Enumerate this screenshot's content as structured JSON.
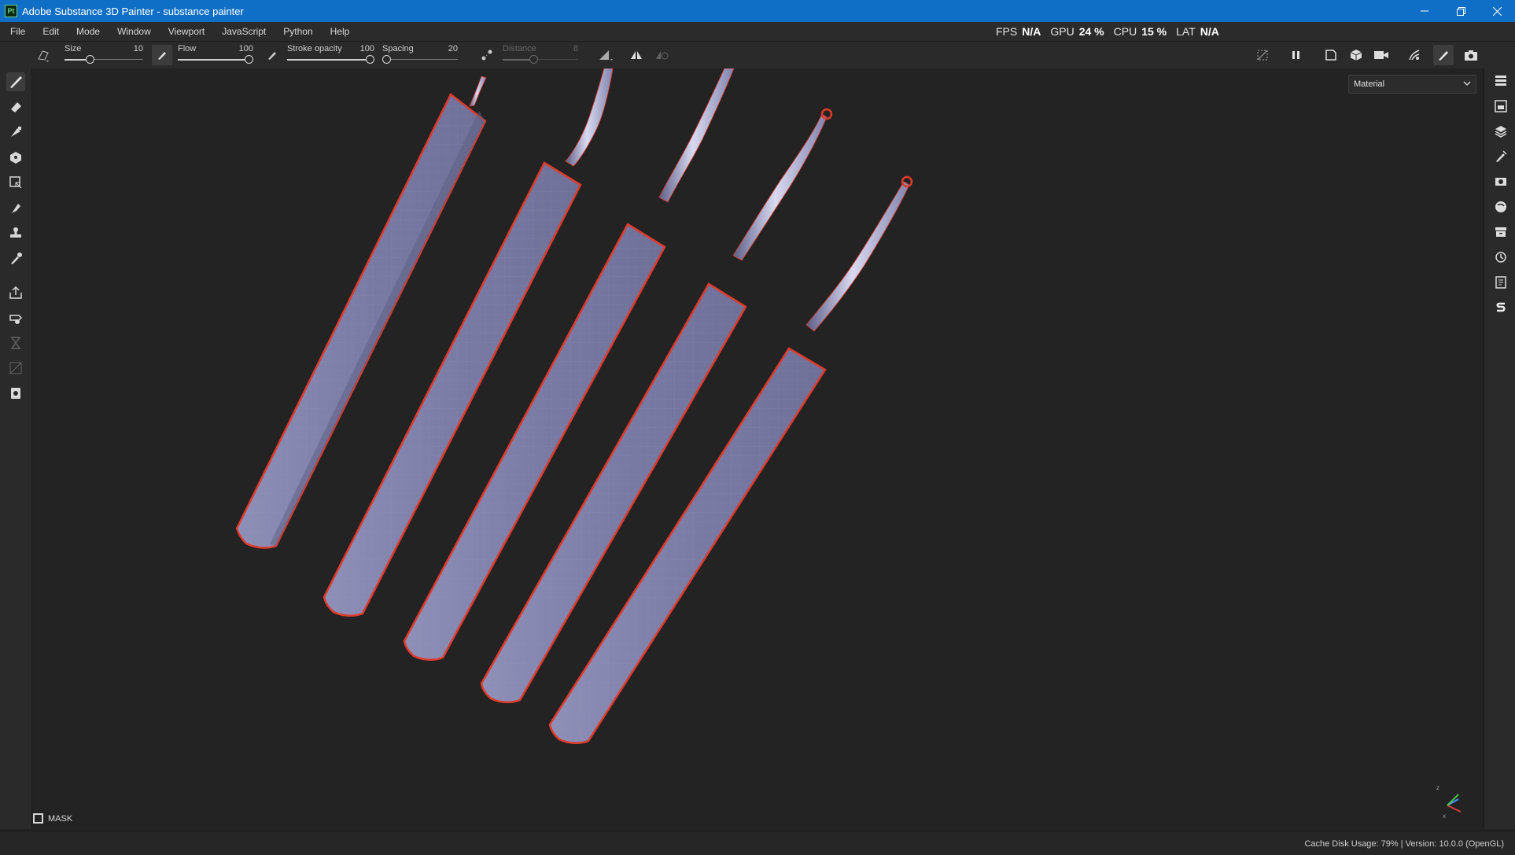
{
  "window": {
    "title": "Adobe Substance 3D Painter - substance painter",
    "app_icon_text": "Pt",
    "controls": [
      "minimize-icon",
      "restore-icon",
      "close-icon"
    ]
  },
  "menu": {
    "items": [
      "File",
      "Edit",
      "Mode",
      "Window",
      "Viewport",
      "JavaScript",
      "Python",
      "Help"
    ]
  },
  "stats": {
    "fps_label": "FPS",
    "fps_value": "N/A",
    "gpu_label": "GPU",
    "gpu_value": "24 %",
    "cpu_label": "CPU",
    "cpu_value": "15 %",
    "lat_label": "LAT",
    "lat_value": "N/A"
  },
  "tool_options": {
    "size": {
      "label": "Size",
      "value": "10",
      "level": 0.3
    },
    "flow": {
      "label": "Flow",
      "value": "100",
      "level": 1.0
    },
    "stroke_opacity": {
      "label": "Stroke opacity",
      "value": "100",
      "level": 1.0
    },
    "spacing": {
      "label": "Spacing",
      "value": "20",
      "level": 0.0
    },
    "distance": {
      "label": "Distance",
      "value": "8",
      "level": 0.4,
      "enabled": false
    }
  },
  "viewport": {
    "material_mode": "Material",
    "mask_label": "MASK",
    "gizmo_labels": {
      "z": "z",
      "x": "x"
    },
    "selection_color": "#e03a2a",
    "mesh_color": "#7c7ea6"
  },
  "left_tools": [
    "paint-brush-icon",
    "eraser-icon",
    "projection-icon",
    "polygon-fill-icon",
    "geometry-mask-icon",
    "smudge-icon",
    "clone-stamp-icon",
    "color-picker-icon",
    "export-icon",
    "bake-icon",
    "hourglass-icon",
    "uv-icon",
    "report-icon"
  ],
  "right_tools": [
    "layers-panel-icon",
    "texture-set-icon",
    "stack-icon",
    "brush-panel-icon",
    "display-settings-icon",
    "shader-icon",
    "assets-icon",
    "history-icon",
    "log-icon",
    "substance-icon"
  ],
  "status": {
    "text": "Cache Disk Usage:    79% | Version: 10.0.0 (OpenGL)"
  }
}
